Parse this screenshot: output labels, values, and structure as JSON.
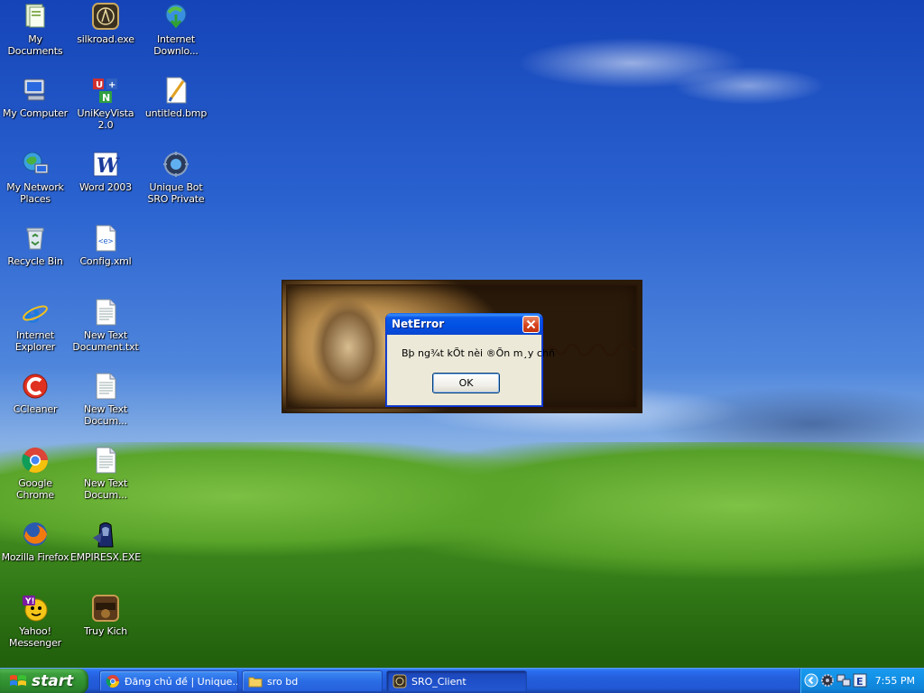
{
  "desktop": {
    "icons": [
      {
        "label": "My Documents"
      },
      {
        "label": "silkroad.exe"
      },
      {
        "label": "Internet Downlo..."
      },
      {
        "label": "My Computer"
      },
      {
        "label": "UniKeyVista 2.0"
      },
      {
        "label": "untitled.bmp"
      },
      {
        "label": "My Network Places"
      },
      {
        "label": "Word 2003"
      },
      {
        "label": "Unique Bot SRO Private"
      },
      {
        "label": "Recycle Bin"
      },
      {
        "label": "Config.xml"
      },
      {
        "label": "Internet Explorer"
      },
      {
        "label": "New Text Document.txt"
      },
      {
        "label": "CCleaner"
      },
      {
        "label": "New Text Docum..."
      },
      {
        "label": "Google Chrome"
      },
      {
        "label": "New Text Docum..."
      },
      {
        "label": "Mozilla Firefox"
      },
      {
        "label": "EMPIRESX.EXE"
      },
      {
        "label": "Yahoo! Messenger"
      },
      {
        "label": "Truy Kich"
      }
    ]
  },
  "dialog": {
    "title": "NetError",
    "message": "Bþ ng¾t kÕt nèi ®Õn m¸y chñ",
    "ok_label": "OK"
  },
  "taskbar": {
    "start_label": "start",
    "tasks": [
      {
        "label": "Đăng chủ đề | Unique..."
      },
      {
        "label": "sro bd"
      },
      {
        "label": "SRO_Client"
      }
    ],
    "clock": "7:55 PM"
  },
  "colors": {
    "taskbar_blue": "#245edb",
    "start_green": "#3c9e3c",
    "tray_blue": "#1290e6",
    "dialog_face": "#ece9d8",
    "close_red": "#d6431c"
  }
}
